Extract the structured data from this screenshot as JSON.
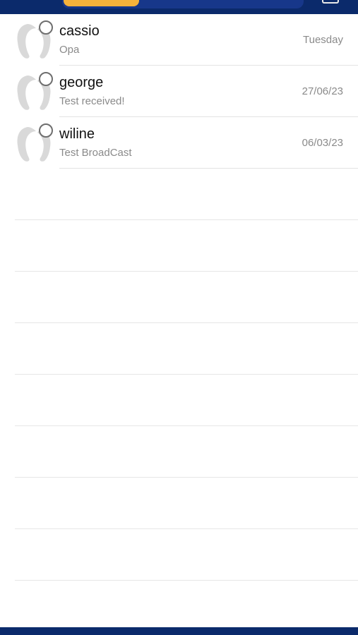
{
  "colors": {
    "header_bg": "#0b2a6b",
    "segment_active": "#f6b23a",
    "divider": "#e3e3e3",
    "name_text": "#111111",
    "meta_text": "#8a8a8a"
  },
  "conversations": [
    {
      "name": "cassio",
      "preview": "Opa",
      "date": "Tuesday"
    },
    {
      "name": "george",
      "preview": "Test received!",
      "date": "27/06/23"
    },
    {
      "name": "wiline",
      "preview": "Test BroadCast",
      "date": "06/03/23"
    }
  ]
}
